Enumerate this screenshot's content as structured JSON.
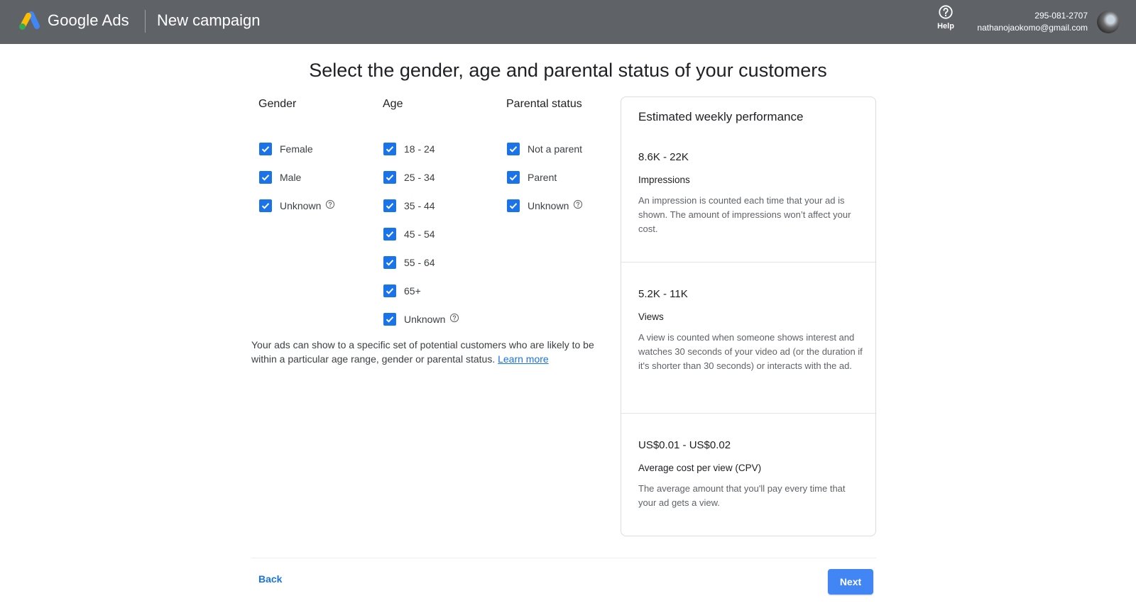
{
  "header": {
    "brand": "Google Ads",
    "title": "New campaign",
    "help_label": "Help",
    "account_id": "295-081-2707",
    "account_email": "nathanojaokomo@gmail.com",
    "icons": {
      "logo": "google-ads-logo",
      "help": "help-circle-icon",
      "avatar": "user-avatar"
    }
  },
  "page": {
    "title": "Select the gender, age and parental status of your customers"
  },
  "targeting": {
    "gender": {
      "heading": "Gender",
      "options": [
        {
          "label": "Female",
          "checked": true,
          "help": false
        },
        {
          "label": "Male",
          "checked": true,
          "help": false
        },
        {
          "label": "Unknown",
          "checked": true,
          "help": true
        }
      ]
    },
    "age": {
      "heading": "Age",
      "options": [
        {
          "label": "18 - 24",
          "checked": true,
          "help": false
        },
        {
          "label": "25 - 34",
          "checked": true,
          "help": false
        },
        {
          "label": "35 - 44",
          "checked": true,
          "help": false
        },
        {
          "label": "45 - 54",
          "checked": true,
          "help": false
        },
        {
          "label": "55 - 64",
          "checked": true,
          "help": false
        },
        {
          "label": "65+",
          "checked": true,
          "help": false
        },
        {
          "label": "Unknown",
          "checked": true,
          "help": true
        }
      ]
    },
    "parental": {
      "heading": "Parental status",
      "options": [
        {
          "label": "Not a parent",
          "checked": true,
          "help": false
        },
        {
          "label": "Parent",
          "checked": true,
          "help": false
        },
        {
          "label": "Unknown",
          "checked": true,
          "help": true
        }
      ]
    },
    "description": "Your ads can show to a specific set of potential customers who are likely to be within a particular age range, gender or parental status.",
    "learn_more": "Learn more"
  },
  "performance": {
    "title": "Estimated weekly performance",
    "metrics": [
      {
        "value": "8.6K - 22K",
        "label": "Impressions",
        "description": "An impression is counted each time that your ad is shown. The amount of impressions won’t affect your cost."
      },
      {
        "value": "5.2K - 11K",
        "label": "Views",
        "description": "A view is counted when someone shows interest and watches 30 seconds of your video ad (or the duration if it's shorter than 30 seconds) or interacts with the ad."
      },
      {
        "value": "US$0.01 - US$0.02",
        "label": "Average cost per view (CPV)",
        "description": "The average amount that you'll pay every time that your ad gets a view."
      }
    ]
  },
  "footer": {
    "back_label": "Back",
    "next_label": "Next"
  },
  "colors": {
    "header_bg": "#5f6368",
    "accent": "#1a73e8",
    "next_button": "#4285f4"
  }
}
